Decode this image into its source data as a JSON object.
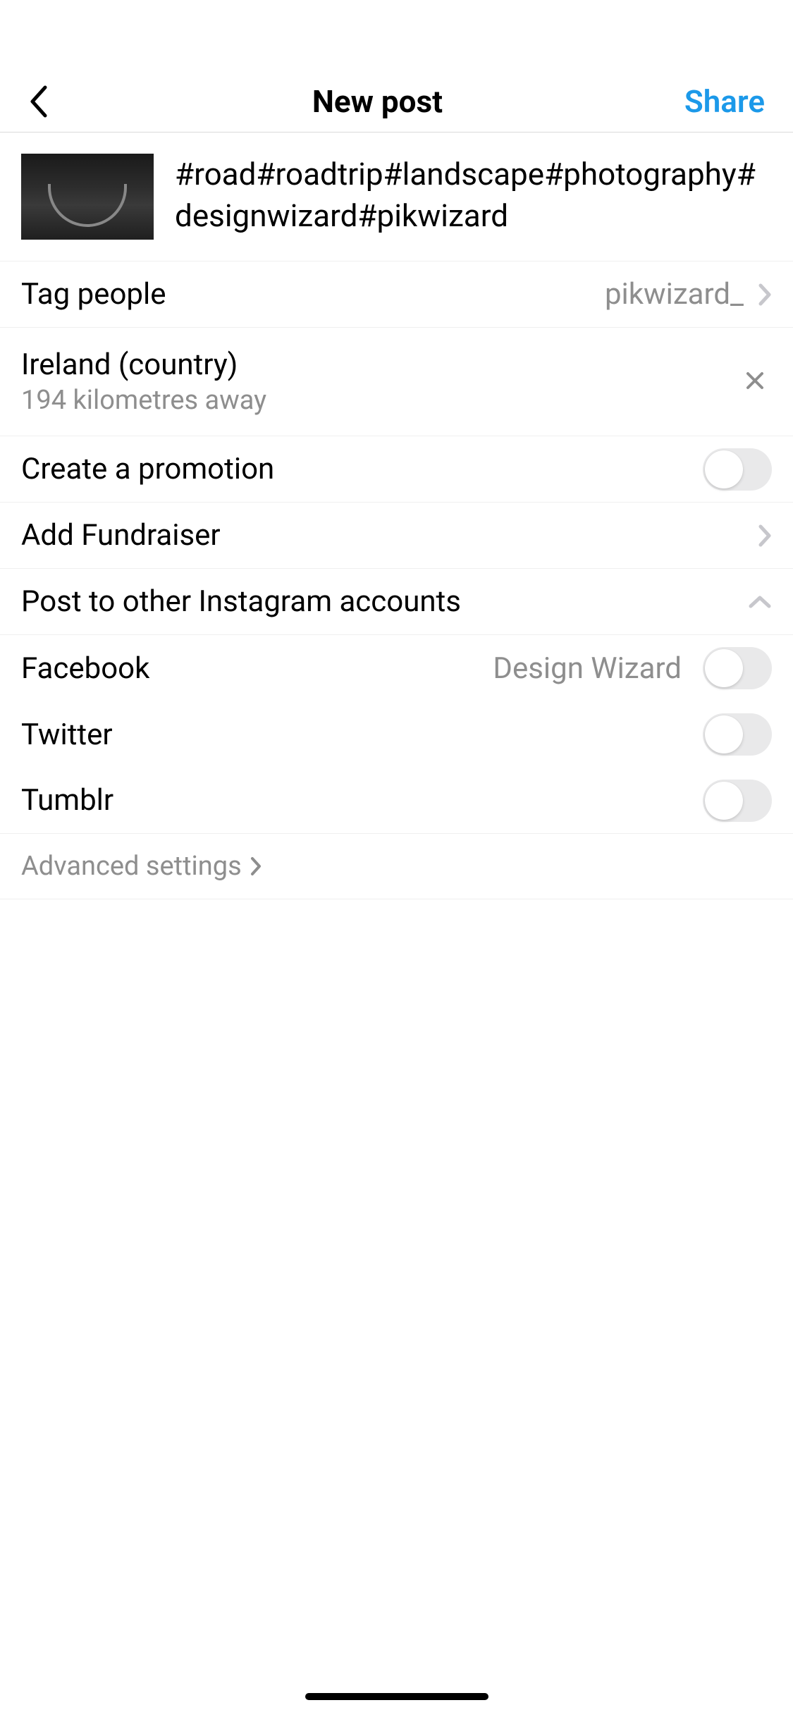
{
  "nav": {
    "title": "New post",
    "share": "Share"
  },
  "caption": "#road#roadtrip#landscape#photography#designwizard#pikwizard",
  "tag_people": {
    "label": "Tag people",
    "value": "pikwizard_"
  },
  "location": {
    "name": "Ireland (country)",
    "distance": "194 kilometres away"
  },
  "promotion": {
    "label": "Create a promotion",
    "enabled": false
  },
  "fundraiser": {
    "label": "Add Fundraiser"
  },
  "post_other": {
    "label": "Post to other Instagram accounts"
  },
  "share_targets": {
    "facebook": {
      "label": "Facebook",
      "account": "Design Wizard",
      "enabled": false
    },
    "twitter": {
      "label": "Twitter",
      "enabled": false
    },
    "tumblr": {
      "label": "Tumblr",
      "enabled": false
    }
  },
  "advanced": {
    "label": "Advanced settings"
  }
}
